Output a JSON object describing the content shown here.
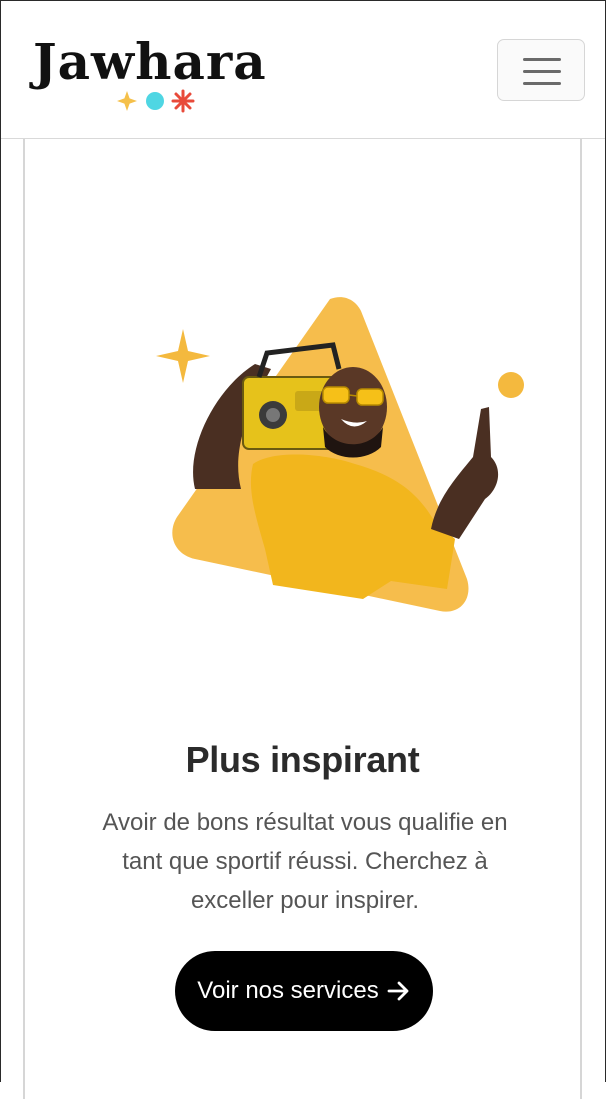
{
  "navbar": {
    "brand": "Jawhara",
    "brand_dot_colors": [
      "#f5c04a",
      "#4fd6e3",
      "#e84a3a"
    ],
    "menu_icon": "hamburger-menu-icon"
  },
  "card": {
    "illustration": "man-with-boombox-on-yellow-triangle",
    "accent_color": "#f6bd4c",
    "title": "Plus inspirant",
    "text": "Avoir de bons résultat vous qualifie en tant que sportif réussi. Cherchez à exceller pour inspirer.",
    "cta_label": "Voir nos services",
    "cta_icon": "arrow-right-icon"
  }
}
